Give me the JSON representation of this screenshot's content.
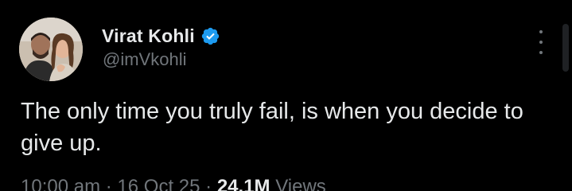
{
  "author": {
    "display_name": "Virat Kohli",
    "handle": "@imVkohli",
    "verified": true,
    "verified_color": "#1d9bf0"
  },
  "tweet": {
    "text": "The only time you truly fail, is when you decide to give up."
  },
  "meta": {
    "time": "10:00 am",
    "separator": "·",
    "date": "16 Oct 25",
    "views_count": "24.1M",
    "views_label": "Views"
  },
  "icons": {
    "more": "more-vertical-icon",
    "verified": "verified-badge-icon"
  },
  "colors": {
    "background": "#000000",
    "primary_text": "#e7e9ea",
    "secondary_text": "#71767b"
  }
}
